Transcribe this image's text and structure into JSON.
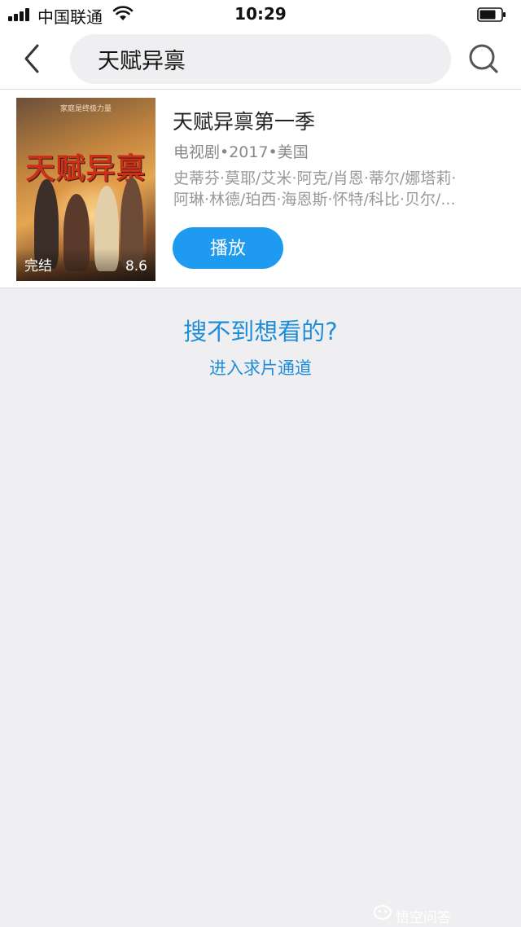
{
  "status_bar": {
    "carrier": "中国联通",
    "time": "10:29"
  },
  "header": {
    "back_icon": "chevron-left-icon",
    "search_value": "天赋异禀",
    "search_icon": "search-icon"
  },
  "result": {
    "poster": {
      "tagline": "家庭是终极力量",
      "title_art": "天赋异禀",
      "status": "完结",
      "score": "8.6"
    },
    "title": "天赋异禀第一季",
    "meta": "电视剧•2017•美国",
    "cast_line1": "史蒂芬·莫耶/艾米·阿克/肖恩·蒂尔/娜塔莉·",
    "cast_line2": "阿琳·林德/珀西·海恩斯·怀特/科比·贝尔/...",
    "play_label": "播放"
  },
  "no_result": {
    "prompt": "搜不到想看的?",
    "channel_link": "进入求片通道"
  },
  "watermark": {
    "text": "悟空问答"
  },
  "colors": {
    "accent": "#1e9bf0",
    "link": "#1f8ed8",
    "background": "#efeff1"
  }
}
